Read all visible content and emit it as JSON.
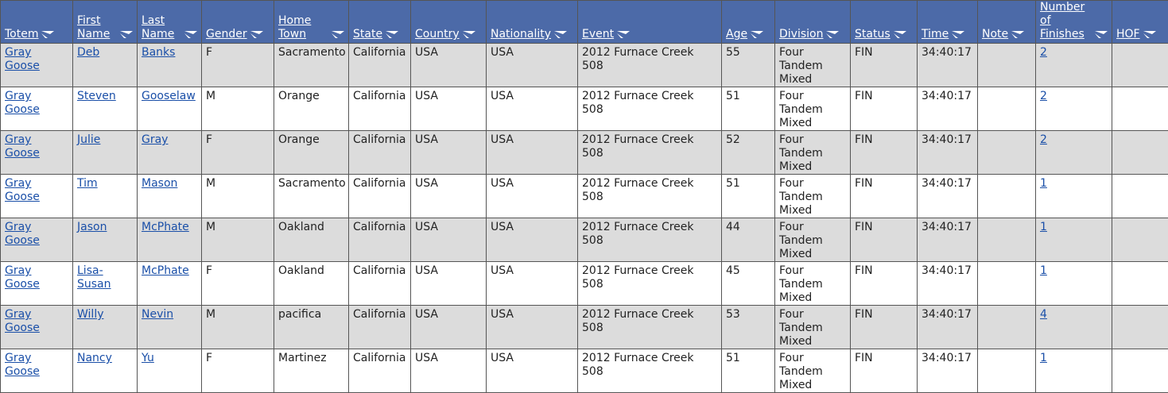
{
  "columns": [
    "Totem",
    "First Name",
    "Last Name",
    "Gender",
    "Home Town",
    "State",
    "Country",
    "Nationality",
    "Event",
    "Age",
    "Division",
    "Status",
    "Time",
    "Note",
    "Number of Finishes",
    "HOF"
  ],
  "rows": [
    {
      "totem": "Gray Goose",
      "first": "Deb",
      "last": "Banks",
      "gender": "F",
      "hometown": "Sacramento",
      "state": "California",
      "country": "USA",
      "nationality": "USA",
      "event": "2012 Furnace Creek 508",
      "age": "55",
      "division": "Four Tandem Mixed",
      "status": "FIN",
      "time": "34:40:17",
      "note": "",
      "finishes": "2",
      "hof": ""
    },
    {
      "totem": "Gray Goose",
      "first": "Steven",
      "last": "Gooselaw",
      "gender": "M",
      "hometown": "Orange",
      "state": "California",
      "country": "USA",
      "nationality": "USA",
      "event": "2012 Furnace Creek 508",
      "age": "51",
      "division": "Four Tandem Mixed",
      "status": "FIN",
      "time": "34:40:17",
      "note": "",
      "finishes": "2",
      "hof": ""
    },
    {
      "totem": "Gray Goose",
      "first": "Julie",
      "last": "Gray",
      "gender": "F",
      "hometown": "Orange",
      "state": "California",
      "country": "USA",
      "nationality": "USA",
      "event": "2012 Furnace Creek 508",
      "age": "52",
      "division": "Four Tandem Mixed",
      "status": "FIN",
      "time": "34:40:17",
      "note": "",
      "finishes": "2",
      "hof": ""
    },
    {
      "totem": "Gray Goose",
      "first": "Tim",
      "last": "Mason",
      "gender": "M",
      "hometown": "Sacramento",
      "state": "California",
      "country": "USA",
      "nationality": "USA",
      "event": "2012 Furnace Creek 508",
      "age": "51",
      "division": "Four Tandem Mixed",
      "status": "FIN",
      "time": "34:40:17",
      "note": "",
      "finishes": "1",
      "hof": ""
    },
    {
      "totem": "Gray Goose",
      "first": "Jason",
      "last": "McPhate",
      "gender": "M",
      "hometown": "Oakland",
      "state": "California",
      "country": "USA",
      "nationality": "USA",
      "event": "2012 Furnace Creek 508",
      "age": "44",
      "division": "Four Tandem Mixed",
      "status": "FIN",
      "time": "34:40:17",
      "note": "",
      "finishes": "1",
      "hof": ""
    },
    {
      "totem": "Gray Goose",
      "first": "Lisa-Susan",
      "last": "McPhate",
      "gender": "F",
      "hometown": "Oakland",
      "state": "California",
      "country": "USA",
      "nationality": "USA",
      "event": "2012 Furnace Creek 508",
      "age": "45",
      "division": "Four Tandem Mixed",
      "status": "FIN",
      "time": "34:40:17",
      "note": "",
      "finishes": "1",
      "hof": ""
    },
    {
      "totem": "Gray Goose",
      "first": "Willy",
      "last": "Nevin",
      "gender": "M",
      "hometown": "pacifica",
      "state": "California",
      "country": "USA",
      "nationality": "USA",
      "event": "2012 Furnace Creek 508",
      "age": "53",
      "division": "Four Tandem Mixed",
      "status": "FIN",
      "time": "34:40:17",
      "note": "",
      "finishes": "4",
      "hof": ""
    },
    {
      "totem": "Gray Goose",
      "first": "Nancy",
      "last": "Yu",
      "gender": "F",
      "hometown": "Martinez",
      "state": "California",
      "country": "USA",
      "nationality": "USA",
      "event": "2012 Furnace Creek 508",
      "age": "51",
      "division": "Four Tandem Mixed",
      "status": "FIN",
      "time": "34:40:17",
      "note": "",
      "finishes": "1",
      "hof": ""
    }
  ],
  "icons": {
    "sort": "sort-toggle-icon"
  },
  "colors": {
    "header_bg": "#4c6aa8",
    "alt_row_bg": "#dcdcdc",
    "link": "#1a4fa8",
    "border": "#555555"
  }
}
